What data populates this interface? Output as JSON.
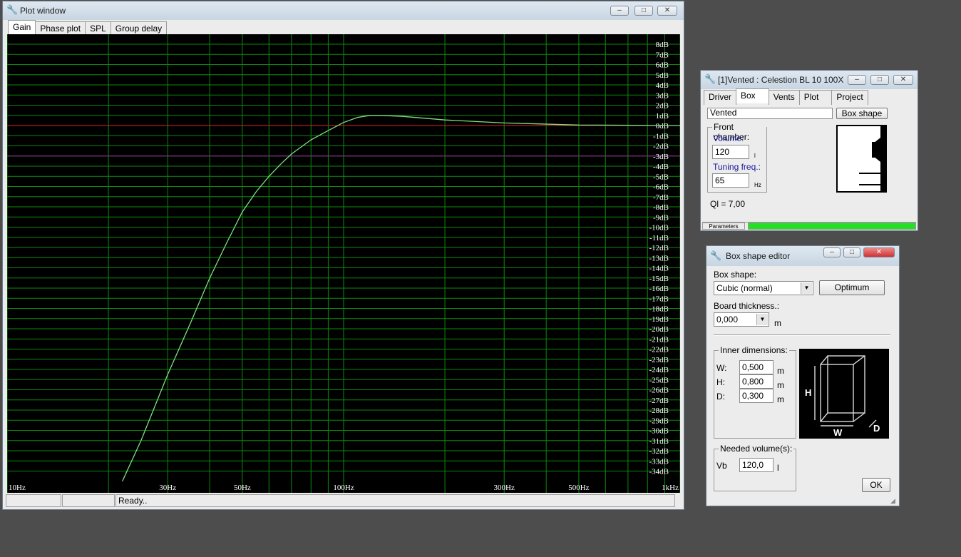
{
  "plot_window": {
    "title": "Plot window",
    "tabs": [
      "Gain",
      "Phase plot",
      "SPL",
      "Group delay"
    ],
    "status": [
      "",
      "",
      "Ready.."
    ],
    "colors": {
      "grid": "#0a8a0a",
      "curve": "#7ee07e",
      "zero_line": "#e02020",
      "minus3_line": "#a020a0"
    }
  },
  "chart_data": {
    "type": "line",
    "x_scale": "log",
    "x_ticks": [
      {
        "value": 10,
        "label": "10Hz"
      },
      {
        "value": 30,
        "label": "30Hz"
      },
      {
        "value": 50,
        "label": "50Hz"
      },
      {
        "value": 100,
        "label": "100Hz"
      },
      {
        "value": 300,
        "label": "300Hz"
      },
      {
        "value": 500,
        "label": "500Hz"
      },
      {
        "value": 1000,
        "label": "1kHz"
      }
    ],
    "xlim": [
      10,
      1000
    ],
    "ylim": [
      -35,
      9
    ],
    "y_ticks": [
      8,
      7,
      6,
      5,
      4,
      3,
      2,
      1,
      0,
      -1,
      -2,
      -3,
      -4,
      -5,
      -6,
      -7,
      -8,
      -9,
      -10,
      -11,
      -12,
      -13,
      -14,
      -15,
      -16,
      -17,
      -18,
      -19,
      -20,
      -21,
      -22,
      -23,
      -24,
      -25,
      -26,
      -27,
      -28,
      -29,
      -30,
      -31,
      -32,
      -33,
      -34
    ],
    "y_unit": "dB",
    "reference_lines": [
      0,
      -3
    ],
    "series": [
      {
        "x": [
          22,
          25,
          30,
          35,
          40,
          45,
          50,
          55,
          60,
          65,
          70,
          80,
          90,
          100,
          110,
          120,
          130,
          150,
          200,
          300,
          500,
          1000
        ],
        "y": [
          -35,
          -31,
          -24.5,
          -19.5,
          -15,
          -11.5,
          -8.5,
          -6.5,
          -5,
          -3.8,
          -2.8,
          -1.4,
          -0.5,
          0.3,
          0.8,
          1.0,
          1.0,
          0.9,
          0.55,
          0.25,
          0.05,
          0.0
        ]
      }
    ]
  },
  "vented_window": {
    "title": "[1]Vented : Celestion BL 10 100X",
    "tabs": [
      "Driver",
      "Box",
      "Vents",
      "Plot",
      "Project"
    ],
    "box_type": "Vented",
    "box_shape_button": "Box shape",
    "front_chamber": "Front chamber:",
    "volume_label": "Volume:",
    "volume_value": "120",
    "volume_unit": "l",
    "tuning_label": "Tuning freq.:",
    "tuning_value": "65",
    "tuning_unit": "Hz",
    "ql": "Ql = 7,00",
    "status_left": "Parameters",
    "progress": 1.0
  },
  "box_shape_editor": {
    "title": "Box shape editor",
    "box_shape_label": "Box shape:",
    "box_shape_value": "Cubic (normal)",
    "optimum_button": "Optimum",
    "board_label": "Board thickness.:",
    "board_value": "0,000",
    "board_unit": "m",
    "inner_title": "Inner dimensions:",
    "dims": [
      {
        "label": "W:",
        "value": "0,500",
        "unit": "m"
      },
      {
        "label": "H:",
        "value": "0,800",
        "unit": "m"
      },
      {
        "label": "D:",
        "value": "0,300",
        "unit": "m"
      }
    ],
    "needed_title": "Needed volume(s):",
    "vb_label": "Vb",
    "vb_value": "120,0",
    "vb_unit": "l",
    "ok_button": "OK",
    "diagram_labels": {
      "h": "H",
      "w": "W",
      "d": "D"
    }
  }
}
